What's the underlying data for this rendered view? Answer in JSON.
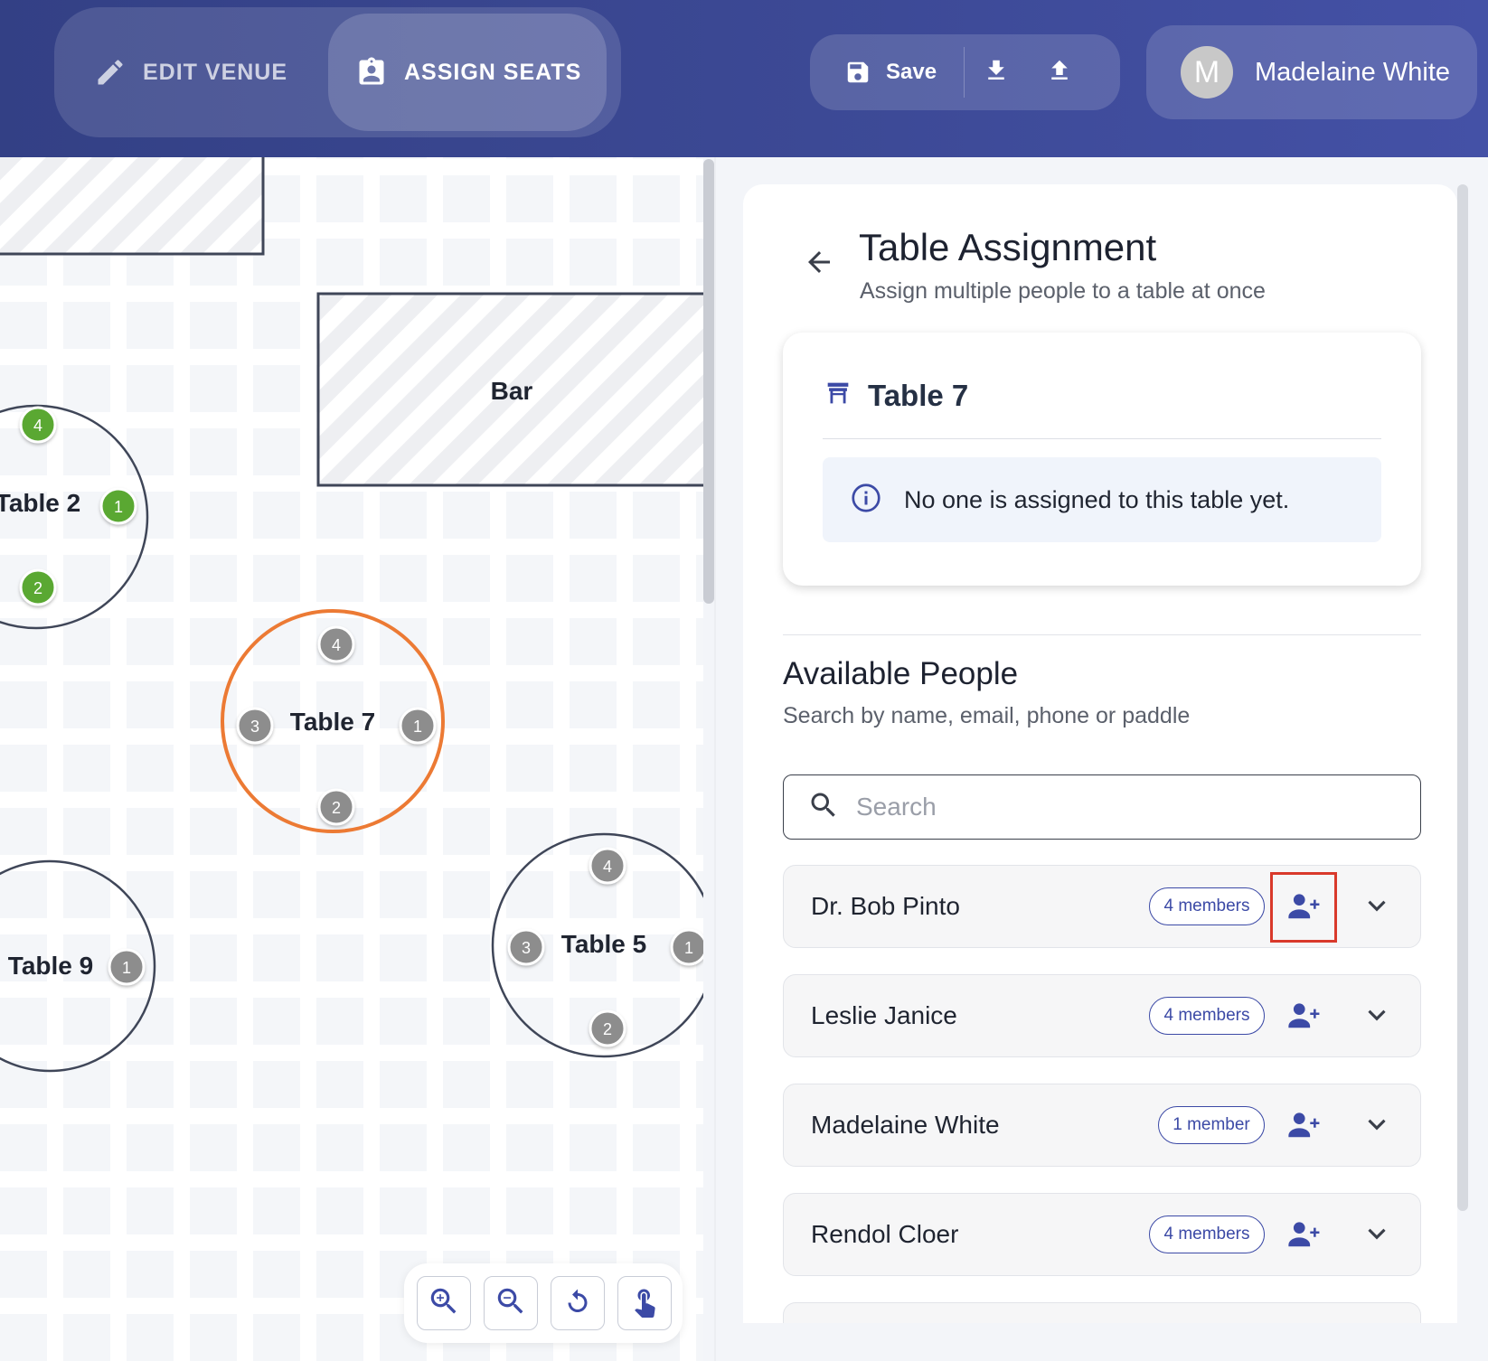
{
  "header": {
    "modes": {
      "edit_label": "EDIT VENUE",
      "assign_label": "ASSIGN SEATS",
      "active": "assign"
    },
    "actions": {
      "save_label": "Save"
    },
    "user": {
      "initial": "M",
      "name": "Madelaine White"
    }
  },
  "canvas": {
    "areas": [
      {
        "label": "Bar"
      }
    ],
    "tables": [
      {
        "label": "Table 2",
        "seats": [
          "4",
          "1",
          "2"
        ],
        "seat_color": "green"
      },
      {
        "label": "Table 7",
        "seats": [
          "4",
          "3",
          "1",
          "2"
        ],
        "selected": true
      },
      {
        "label": "Table 9",
        "seats": [
          "1"
        ]
      },
      {
        "label": "Table 5",
        "seats": [
          "4",
          "3",
          "1",
          "2"
        ]
      }
    ]
  },
  "panel": {
    "title": "Table Assignment",
    "subtitle": "Assign multiple people to a table at once",
    "table_card": {
      "title": "Table 7",
      "info": "No one is assigned to this table yet."
    },
    "available": {
      "title": "Available People",
      "subtitle": "Search by name, email, phone or paddle",
      "search_placeholder": "Search",
      "people": [
        {
          "name": "Dr. Bob Pinto",
          "badge": "4 members",
          "highlighted": true
        },
        {
          "name": "Leslie Janice",
          "badge": "4 members"
        },
        {
          "name": "Madelaine White",
          "badge": "1 member"
        },
        {
          "name": "Rendol Cloer",
          "badge": "4 members"
        }
      ]
    }
  },
  "colors": {
    "header": "#3c4995",
    "accent": "#3c4aa6",
    "selected_table": "#ec7a34",
    "seat_green": "#5aa832",
    "seat_gray": "#8d8d8d",
    "highlight": "#d9392b"
  }
}
